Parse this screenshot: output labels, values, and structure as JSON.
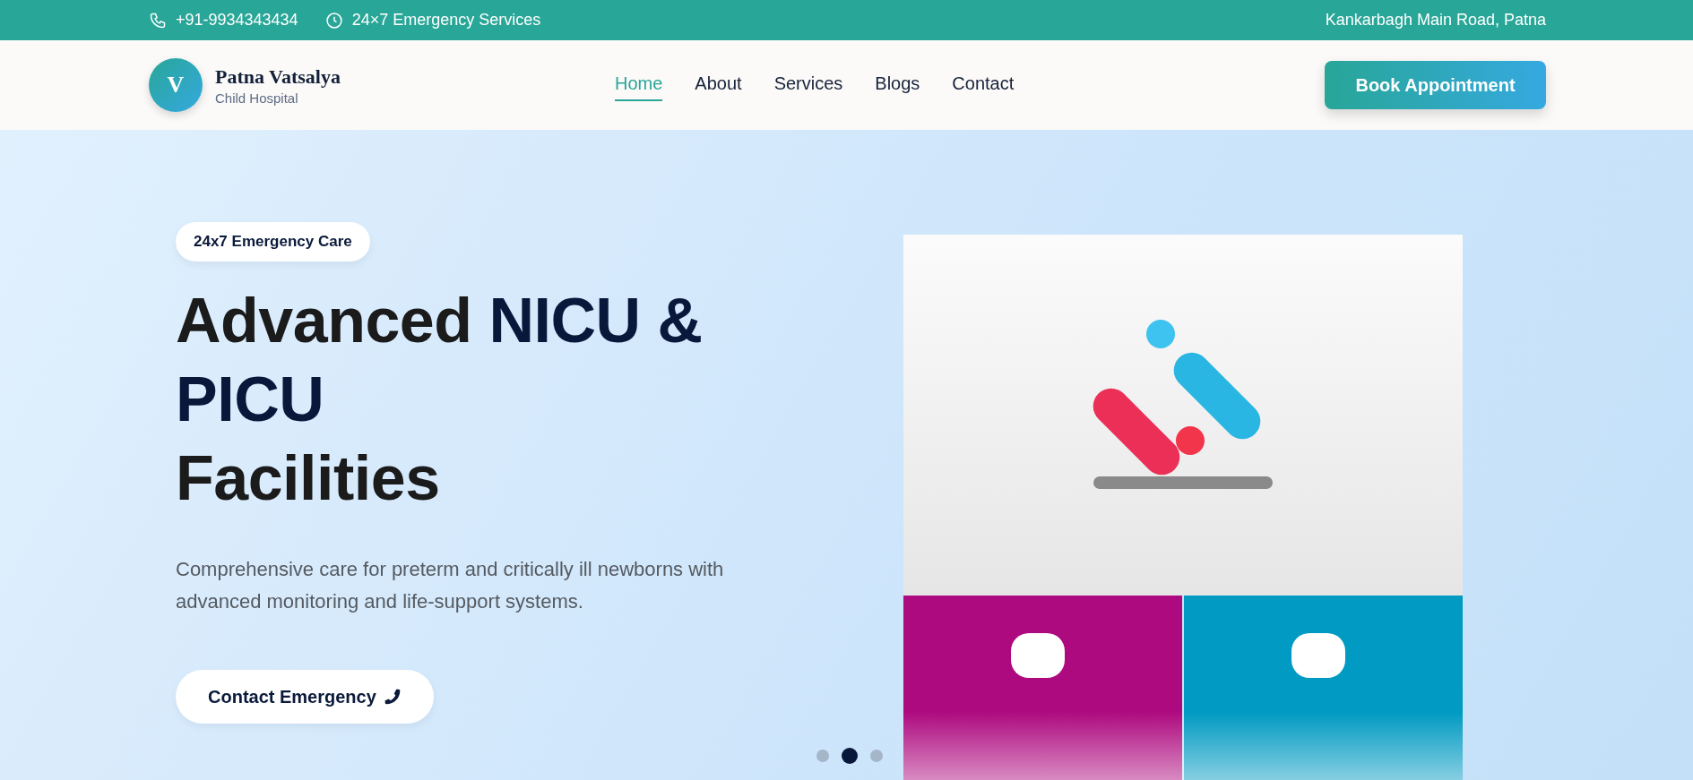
{
  "top_bar": {
    "phone": "+91-9934343434",
    "hours": "24×7 Emergency Services",
    "address": "Kankarbagh Main Road, Patna"
  },
  "brand": {
    "initial": "V",
    "name": "Patna Vatsalya",
    "subtitle": "Child Hospital"
  },
  "nav": [
    {
      "label": "Home",
      "selected": true
    },
    {
      "label": "About",
      "selected": false
    },
    {
      "label": "Services",
      "selected": false
    },
    {
      "label": "Blogs",
      "selected": false
    },
    {
      "label": "Contact",
      "selected": false
    }
  ],
  "cta_button": "Book Appointment",
  "hero": {
    "badge": "24x7 Emergency Care",
    "title": [
      {
        "text": "Advanced ",
        "highlight": false
      },
      {
        "text": "NICU & PICU",
        "highlight": true
      },
      {
        "text": "Facilities",
        "highlight": false
      }
    ],
    "description": "Comprehensive care for preterm and critically ill newborns with advanced monitoring and life-support systems.",
    "button": "Contact Emergency",
    "slides": [
      {
        "selected": false
      },
      {
        "selected": true
      },
      {
        "selected": false
      }
    ]
  }
}
